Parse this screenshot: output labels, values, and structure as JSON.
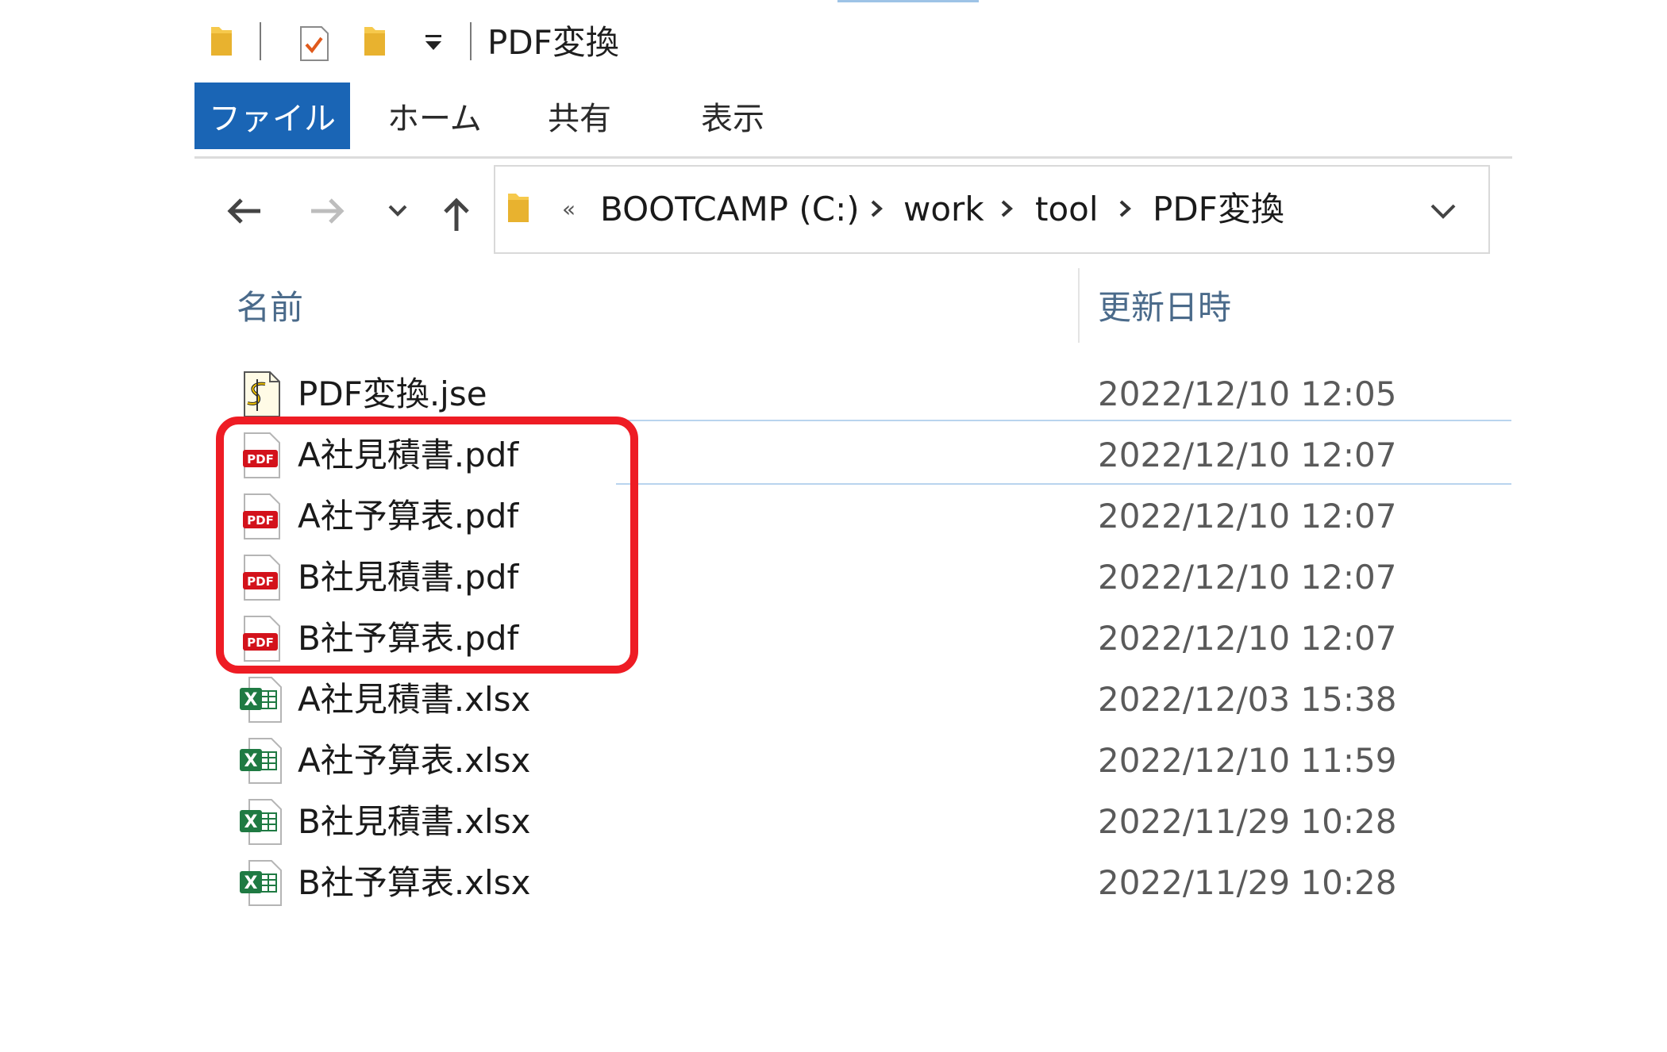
{
  "window": {
    "title": "PDF変換"
  },
  "ribbon": {
    "tabs": [
      "ファイル",
      "ホーム",
      "共有",
      "表示"
    ]
  },
  "address": {
    "overflow": "«",
    "crumbs": [
      "BOOTCAMP (C:)",
      "work",
      "tool",
      "PDF変換"
    ]
  },
  "columns": {
    "name": "名前",
    "modified": "更新日時"
  },
  "files": [
    {
      "name": "PDF変換.jse",
      "date": "2022/12/10 12:05",
      "icon": "script-file-icon"
    },
    {
      "name": "A社見積書.pdf",
      "date": "2022/12/10 12:07",
      "icon": "pdf-file-icon"
    },
    {
      "name": "A社予算表.pdf",
      "date": "2022/12/10 12:07",
      "icon": "pdf-file-icon"
    },
    {
      "name": "B社見積書.pdf",
      "date": "2022/12/10 12:07",
      "icon": "pdf-file-icon"
    },
    {
      "name": "B社予算表.pdf",
      "date": "2022/12/10 12:07",
      "icon": "pdf-file-icon"
    },
    {
      "name": "A社見積書.xlsx",
      "date": "2022/12/03 15:38",
      "icon": "excel-file-icon"
    },
    {
      "name": "A社予算表.xlsx",
      "date": "2022/12/10 11:59",
      "icon": "excel-file-icon"
    },
    {
      "name": "B社見積書.xlsx",
      "date": "2022/11/29 10:28",
      "icon": "excel-file-icon"
    },
    {
      "name": "B社予算表.xlsx",
      "date": "2022/11/29 10:28",
      "icon": "excel-file-icon"
    }
  ],
  "icon_labels": {
    "pdf": "PDF",
    "excel": "X"
  },
  "colors": {
    "accent": "#1a65b5",
    "highlight": "#ee1c24",
    "hover": "#b9d4ee"
  }
}
